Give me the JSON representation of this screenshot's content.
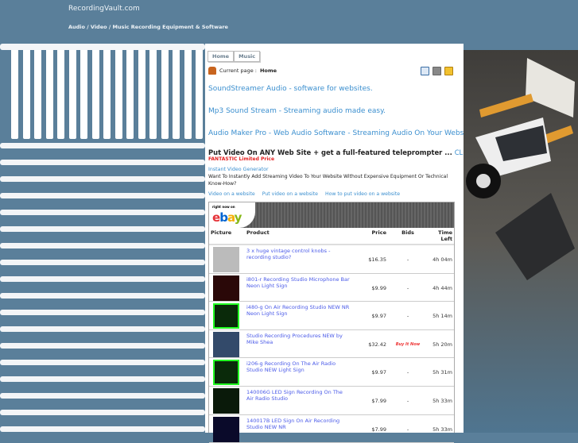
{
  "site": {
    "title": "RecordingVault.com",
    "tagline": "Audio / Video / Music Recording Equipment & Software"
  },
  "tabs": [
    {
      "label": "Home"
    },
    {
      "label": "Music"
    }
  ],
  "breadcrumb": {
    "label": "Current page :",
    "current": "Home"
  },
  "links": [
    "SoundStreamer Audio - software for websites.",
    "Mp3 Sound Stream - Streaming audio made easy.",
    "Audio Maker Pro - Web Audio Software - Streaming Audio On Your Website!"
  ],
  "promo": {
    "headline": "Put Video On ANY Web Site + get a full-featured teleprompter ...",
    "cta": "CLICK HERE",
    "price_note": "FANTASTIC Limited Price",
    "ivg": "Instant Video Generator",
    "desc": "Want To Instantly Add Streaming Video To Your Website Without Expensive Equipment Or Technical Know-How?"
  },
  "video_links": [
    "Video on a website",
    "Put video on a website",
    "How to put video on a website"
  ],
  "ebay": {
    "tagline": "right now on",
    "logo": "ebay",
    "columns": [
      "Picture",
      "Product",
      "Price",
      "Bids",
      "Time Left"
    ],
    "rows": [
      {
        "product": "3 x huge vintage control knobs - recording studio?",
        "price": "$16.35",
        "bids": "-",
        "time": "4h 04m",
        "color": "#bbb"
      },
      {
        "product": "i801-r Recording Studio Microphone Bar Neon Light Sign",
        "price": "$9.99",
        "bids": "-",
        "time": "4h 44m",
        "color": "#2a0808"
      },
      {
        "product": "i480-g On Air Recording Studio NEW NR Neon Light Sign",
        "price": "$9.97",
        "bids": "-",
        "time": "5h 14m",
        "color": "#0a2a0a"
      },
      {
        "product": "Studio Recording Procedures NEW by Mike Shea",
        "price": "$32.42",
        "bids": "Buy It Now",
        "time": "5h 20m",
        "color": "#334a6a"
      },
      {
        "product": "i206-g Recording On The Air Radio Studio NEW Light Sign",
        "price": "$9.97",
        "bids": "-",
        "time": "5h 31m",
        "color": "#0a2a0a"
      },
      {
        "product": "140006G LED Sign Recording On The Air Radio Studio",
        "price": "$7.99",
        "bids": "-",
        "time": "5h 33m",
        "color": "#0a1a0a"
      },
      {
        "product": "140017B LED Sign On Air Recording Studio NEW NR",
        "price": "$7.99",
        "bids": "-",
        "time": "5h 33m",
        "color": "#0a0a2a"
      }
    ]
  }
}
